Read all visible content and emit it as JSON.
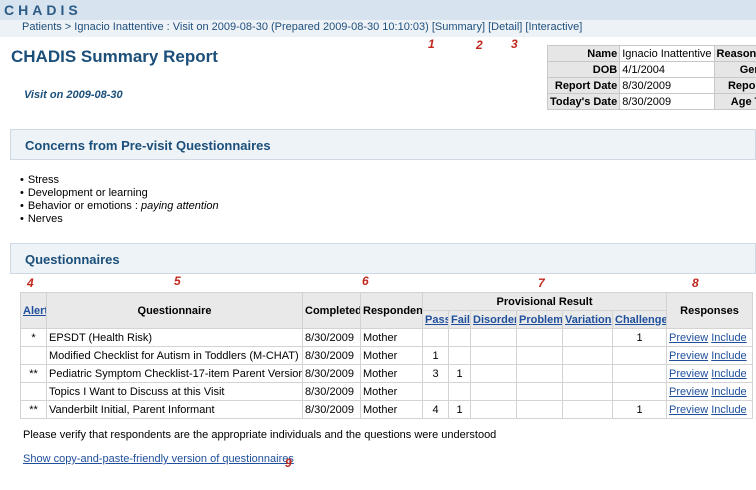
{
  "app": {
    "logo": "CHADIS"
  },
  "breadcrumb": {
    "text": "Patients > Ignacio Inattentive : Visit on 2009-08-30   (Prepared 2009-08-30 10:10:03)",
    "links": [
      "[Summary]",
      "[Detail]",
      "[Interactive]"
    ]
  },
  "markers": [
    "1",
    "2",
    "3",
    "4",
    "5",
    "6",
    "7",
    "8",
    "9"
  ],
  "header": {
    "title": "CHADIS Summary Report",
    "visit": "Visit on 2009-08-30"
  },
  "patient_info": {
    "rows": [
      {
        "label": "Name",
        "value": "Ignacio Inattentive",
        "label2": "Reason for"
      },
      {
        "label": "DOB",
        "value": "4/1/2004",
        "label2": "Gende"
      },
      {
        "label": "Report Date",
        "value": "8/30/2009",
        "label2": "Report A"
      },
      {
        "label": "Today's Date",
        "value": "8/30/2009",
        "label2": "Age Tod"
      }
    ]
  },
  "concerns": {
    "heading": "Concerns from Pre-visit Questionnaires",
    "items": [
      {
        "text": "Stress",
        "detail": ""
      },
      {
        "text": "Development or learning",
        "detail": ""
      },
      {
        "text": "Behavior or emotions : ",
        "detail": "paying attention"
      },
      {
        "text": "Nerves",
        "detail": ""
      }
    ]
  },
  "questionnaires": {
    "heading": "Questionnaires",
    "columns": {
      "alert": "Alert",
      "questionnaire": "Questionnaire",
      "completed": "Completed",
      "respondent": "Respondent",
      "provisional": "Provisional Result",
      "pass": "Pass",
      "fail": "Fail",
      "disorder": "Disorder",
      "problem": "Problem",
      "variation": "Variation",
      "challenge": "Challenge",
      "responses": "Responses"
    },
    "rows": [
      {
        "alert": "*",
        "name": "EPSDT (Health Risk)",
        "completed": "8/30/2009",
        "respondent": "Mother",
        "pass": "",
        "fail": "",
        "disorder": "",
        "problem": "",
        "variation": "",
        "challenge": "1",
        "preview": "Preview",
        "include": "Include"
      },
      {
        "alert": "",
        "name": "Modified Checklist for Autism in Toddlers (M-CHAT)",
        "completed": "8/30/2009",
        "respondent": "Mother",
        "pass": "1",
        "fail": "",
        "disorder": "",
        "problem": "",
        "variation": "",
        "challenge": "",
        "preview": "Preview",
        "include": "Include"
      },
      {
        "alert": "**",
        "name": "Pediatric Symptom Checklist-17-item Parent Version",
        "completed": "8/30/2009",
        "respondent": "Mother",
        "pass": "3",
        "fail": "1",
        "disorder": "",
        "problem": "",
        "variation": "",
        "challenge": "",
        "preview": "Preview",
        "include": "Include"
      },
      {
        "alert": "",
        "name": "Topics I Want to Discuss at this Visit",
        "completed": "8/30/2009",
        "respondent": "Mother",
        "pass": "",
        "fail": "",
        "disorder": "",
        "problem": "",
        "variation": "",
        "challenge": "",
        "preview": "Preview",
        "include": "Include"
      },
      {
        "alert": "**",
        "name": "Vanderbilt Initial, Parent Informant",
        "completed": "8/30/2009",
        "respondent": "Mother",
        "pass": "4",
        "fail": "1",
        "disorder": "",
        "problem": "",
        "variation": "",
        "challenge": "1",
        "preview": "Preview",
        "include": "Include"
      }
    ],
    "note": "Please verify that respondents are the appropriate individuals and the questions were understood",
    "copy_link": "Show copy-and-paste-friendly version of questionnaires"
  }
}
